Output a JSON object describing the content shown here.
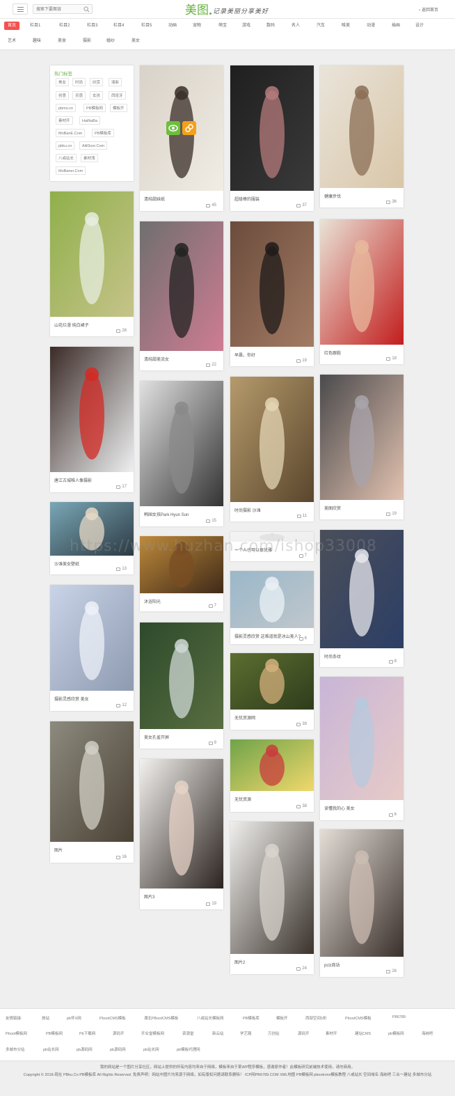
{
  "header": {
    "search_placeholder": "搜索下要面容",
    "logo_main": "美图",
    "logo_slogan": "记录美丽分享美好",
    "back_home": "返回首页"
  },
  "categories": [
    "首页",
    "栏目1",
    "栏目2",
    "栏目3",
    "栏目4",
    "栏目5",
    "动画",
    "宠物",
    "萌宝",
    "游戏",
    "数码",
    "名人",
    "汽车",
    "唯美",
    "动漫",
    "插画",
    "设计",
    "艺术",
    "趣味",
    "美食",
    "摄影",
    "婚纱",
    "美女"
  ],
  "hot_tags": {
    "title": "热门标签",
    "tags": [
      "美女",
      "时尚",
      "欣赏",
      "清新",
      "创意",
      "灵感",
      "女孩",
      "西班牙",
      "pbmo.cn",
      "PB模板网",
      "模板开",
      "素材开",
      "HaiNaBa",
      "MoBanE.Com",
      "PB模板库",
      "pbku.cn",
      "AiliDoor.Com",
      "八戒站长",
      "素材湾",
      "MoBaner.Com"
    ]
  },
  "cards": [
    {
      "title": "清纯甜妹纸",
      "count": "45"
    },
    {
      "title": "超级棒的服装",
      "count": "37"
    },
    {
      "title": "健康步伐",
      "count": "36"
    },
    {
      "title": "山花烂漫 纯白裙子",
      "count": "28"
    },
    {
      "title": "清纯甜美流女",
      "count": "22"
    },
    {
      "title": "早晨，你好",
      "count": "19"
    },
    {
      "title": "红色跟鞋",
      "count": "18"
    },
    {
      "title": "唐江古城唯人像摄影",
      "count": "17"
    },
    {
      "title": "韩国女孩Park Hyun Sun",
      "count": "15"
    },
    {
      "title": "时尚摄影 沙滩",
      "count": "11"
    },
    {
      "title": "美图欣赏",
      "count": "19"
    },
    {
      "title": "沙滩美女壁纸",
      "count": "13"
    },
    {
      "title": "沐浴阳光",
      "count": "7"
    },
    {
      "title": "一个人也可以很优雅",
      "count": "7"
    },
    {
      "title": "时尚条纹",
      "count": "8"
    },
    {
      "title": "摄影灵感欣赏 美女",
      "count": "12"
    },
    {
      "title": "美女孔雀开屏",
      "count": "9"
    },
    {
      "title": "摄影灵感欣赏 这难道就是冰山美人?",
      "count": "6"
    },
    {
      "title": "读懂我的心 美女",
      "count": "6"
    },
    {
      "title": "无忧资源网",
      "count": "39"
    },
    {
      "title": "图片",
      "count": "16"
    },
    {
      "title": "无忧资源",
      "count": "38"
    },
    {
      "title": "图片3",
      "count": "19"
    },
    {
      "title": "图片2",
      "count": "24"
    },
    {
      "title": "pclz商站",
      "count": "26"
    }
  ],
  "watermark": "https://www.huzhan.com/ishop33008",
  "links": {
    "label": "友情链接:",
    "items": [
      "旅站",
      "pb怀X网",
      "PbootCMS模板",
      "湘北PBootCMS模板",
      "八戒站长模板网",
      "PB模板库",
      "模板开",
      "西部空间5折",
      "PbootCMS模板",
      "P86789",
      "Pboot模板网",
      "PB模板网",
      "Pb下载网",
      "源码开",
      "开业堂模板网",
      "资源堂",
      "新云站",
      "学艺路",
      "万创站",
      "源码开",
      "素材开",
      "建站CMS",
      "pb模板网",
      "海纳吧",
      "多城市分站",
      "pb站长网",
      "pb源码网",
      "pb源码网",
      "pb站长网",
      "pb模板代理网"
    ]
  },
  "footer": {
    "line1": "我的网站是一个图片分享社区，网站上提供的所有内容均来自于网络，模板来自于某WP程序模板，感谢原作者！此模板研究前端技术使用，请勿商用。",
    "line2": "Copyright © 2018-现在 PBku.Cn PB模板库 All Rights Reserved. 免责声明：网站中图片均来源于网络，如有版权问题请联系删除！ ICP网PB6789.COM XML地图 PB模板网 pbootcms模板教程 八戒站长 空间域名 海纳吧 三合一建站 多城市分站"
  },
  "colors": {
    "accent": "#67b240",
    "active_tab": "#f4514f",
    "eye_button": "#6cbf3c",
    "link_button": "#f4a11a"
  }
}
